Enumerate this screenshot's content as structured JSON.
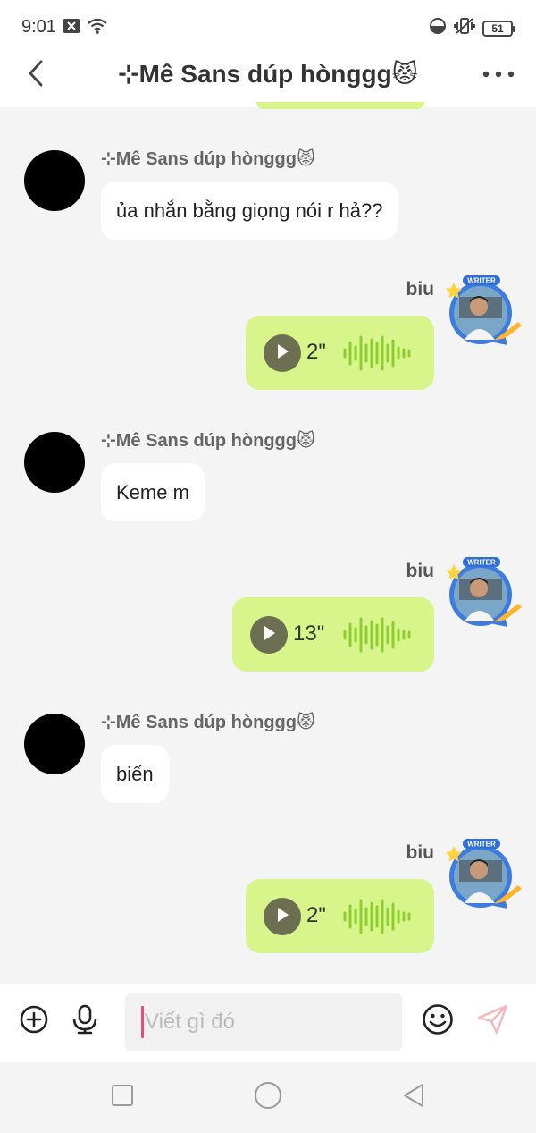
{
  "status_bar": {
    "time": "9:01",
    "battery": "51",
    "icons": [
      "close-box-icon",
      "wifi-icon",
      "data-saver-icon",
      "vibrate-icon",
      "battery-icon"
    ]
  },
  "header": {
    "title": "⊹Mê Sans dúp hònggg😾",
    "icons": [
      "chevron-left-icon",
      "more-horizontal-icon"
    ]
  },
  "messages": [
    {
      "direction": "in",
      "sender": "⊹Mê Sans dúp hònggg😾",
      "text": "ủa nhắn bằng giọng nói r hả??"
    },
    {
      "direction": "out",
      "sender": "biu",
      "type": "voice",
      "duration": "2\""
    },
    {
      "direction": "in",
      "sender": "⊹Mê Sans dúp hònggg😾",
      "text": "Keme m"
    },
    {
      "direction": "out",
      "sender": "biu",
      "type": "voice",
      "duration": "13\""
    },
    {
      "direction": "in",
      "sender": "⊹Mê Sans dúp hònggg😾",
      "text": "biến"
    },
    {
      "direction": "out",
      "sender": "biu",
      "type": "voice",
      "duration": "2\""
    }
  ],
  "avatar_badge": {
    "text": "WRITER"
  },
  "input_bar": {
    "placeholder": "Viết gì đó",
    "icons": [
      "add-circle-icon",
      "microphone-icon",
      "emoji-icon",
      "send-icon"
    ]
  },
  "nav_bar": {
    "icons": [
      "recents-square-icon",
      "home-circle-icon",
      "back-triangle-icon"
    ]
  },
  "colors": {
    "voice_bubble": "#d8f58c",
    "waveform": "#8ccf2e",
    "play_button": "#6c6f51",
    "background": "#f4f4f4",
    "caret": "#e84d7a",
    "send_icon": "#f5b8b8"
  }
}
